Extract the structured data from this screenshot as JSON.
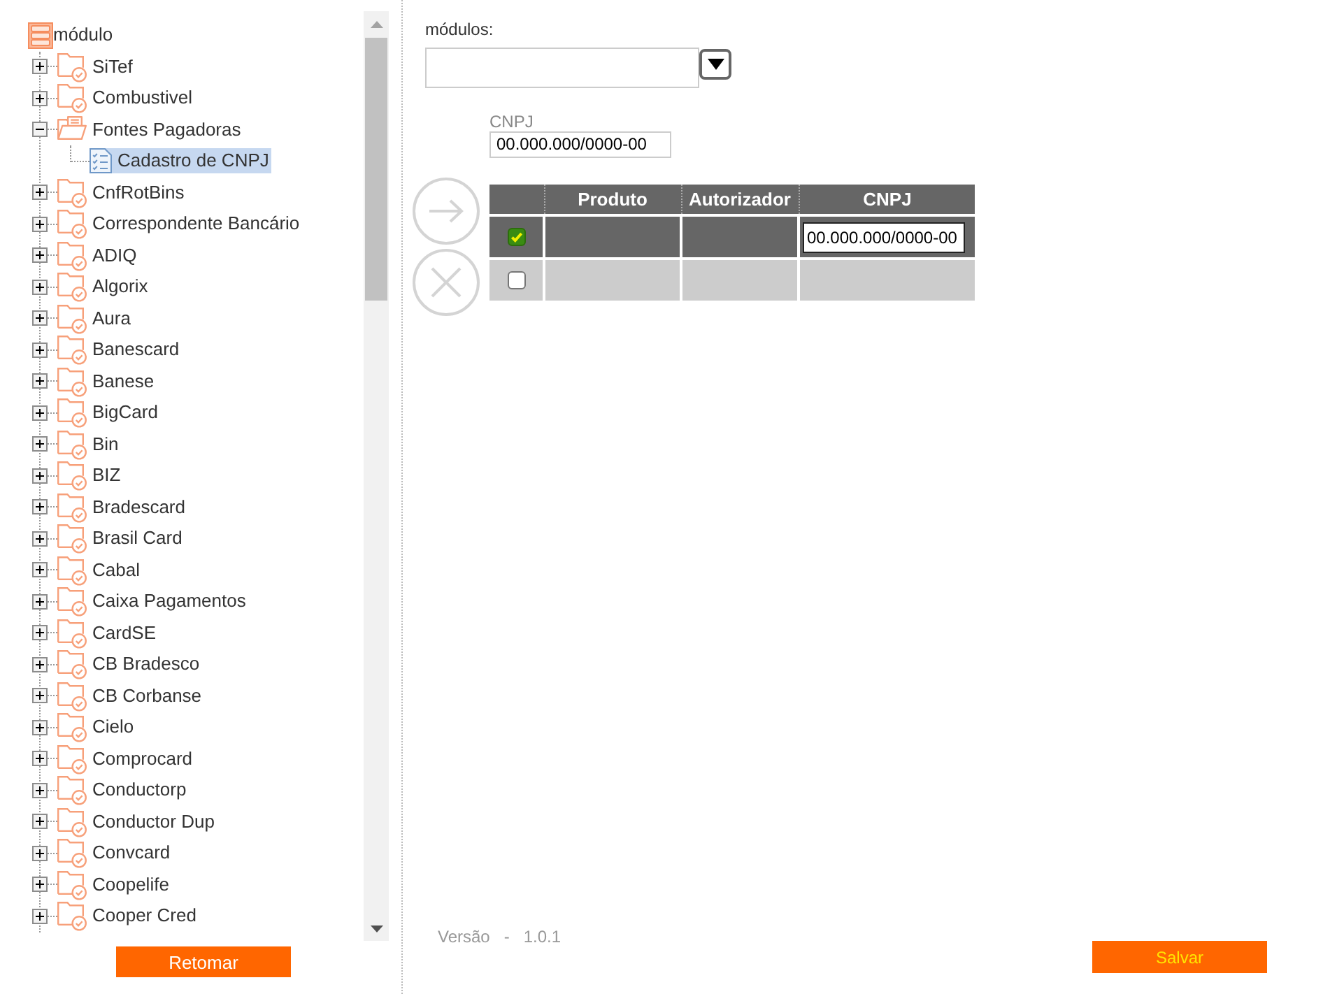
{
  "tree_panel": {
    "root": {
      "label": "módulo",
      "selected": false,
      "children": [
        {
          "label": "SiTef",
          "kind": "folder",
          "expanded": false,
          "selected": false
        },
        {
          "label": "Combustivel",
          "kind": "folder",
          "expanded": false,
          "selected": false
        },
        {
          "label": "Fontes Pagadoras",
          "kind": "folder",
          "expanded": true,
          "selected": false,
          "children": [
            {
              "label": "Cadastro de CNPJ",
              "kind": "form",
              "selected": true
            }
          ]
        },
        {
          "label": "CnfRotBins",
          "kind": "folder",
          "expanded": false,
          "selected": false
        },
        {
          "label": "Correspondente Bancário",
          "kind": "folder",
          "expanded": false,
          "selected": false
        },
        {
          "label": "ADIQ",
          "kind": "folder",
          "expanded": false,
          "selected": false
        },
        {
          "label": "Algorix",
          "kind": "folder",
          "expanded": false,
          "selected": false
        },
        {
          "label": "Aura",
          "kind": "folder",
          "expanded": false,
          "selected": false
        },
        {
          "label": "Banescard",
          "kind": "folder",
          "expanded": false,
          "selected": false
        },
        {
          "label": "Banese",
          "kind": "folder",
          "expanded": false,
          "selected": false
        },
        {
          "label": "BigCard",
          "kind": "folder",
          "expanded": false,
          "selected": false
        },
        {
          "label": "Bin",
          "kind": "folder",
          "expanded": false,
          "selected": false
        },
        {
          "label": "BIZ",
          "kind": "folder",
          "expanded": false,
          "selected": false
        },
        {
          "label": "Bradescard",
          "kind": "folder",
          "expanded": false,
          "selected": false
        },
        {
          "label": "Brasil Card",
          "kind": "folder",
          "expanded": false,
          "selected": false
        },
        {
          "label": "Cabal",
          "kind": "folder",
          "expanded": false,
          "selected": false
        },
        {
          "label": "Caixa Pagamentos",
          "kind": "folder",
          "expanded": false,
          "selected": false
        },
        {
          "label": "CardSE",
          "kind": "folder",
          "expanded": false,
          "selected": false
        },
        {
          "label": "CB Bradesco",
          "kind": "folder",
          "expanded": false,
          "selected": false
        },
        {
          "label": "CB Corbanse",
          "kind": "folder",
          "expanded": false,
          "selected": false
        },
        {
          "label": "Cielo",
          "kind": "folder",
          "expanded": false,
          "selected": false
        },
        {
          "label": "Comprocard",
          "kind": "folder",
          "expanded": false,
          "selected": false
        },
        {
          "label": "Conductorp",
          "kind": "folder",
          "expanded": false,
          "selected": false
        },
        {
          "label": "Conductor Dup",
          "kind": "folder",
          "expanded": false,
          "selected": false
        },
        {
          "label": "Convcard",
          "kind": "folder",
          "expanded": false,
          "selected": false
        },
        {
          "label": "Coopelife",
          "kind": "folder",
          "expanded": false,
          "selected": false
        },
        {
          "label": "Cooper Cred",
          "kind": "folder",
          "expanded": false,
          "selected": false
        }
      ]
    },
    "return_button": "Retomar"
  },
  "form_panel": {
    "modules_select": {
      "label": "módulos:"
    },
    "cnpj_filter": {
      "label": "CNPJ",
      "value": "00.000.000/0000-00"
    },
    "table": {
      "columns": [
        "Produto",
        "Autorizador",
        "CNPJ"
      ],
      "rows": [
        {
          "checked": true,
          "cnpj": "00.000.000/0000-00"
        },
        {
          "checked": false
        }
      ]
    },
    "version": {
      "label": "Versão",
      "separator": "-",
      "number": "1.0.1"
    },
    "save_button": "Salvar"
  }
}
